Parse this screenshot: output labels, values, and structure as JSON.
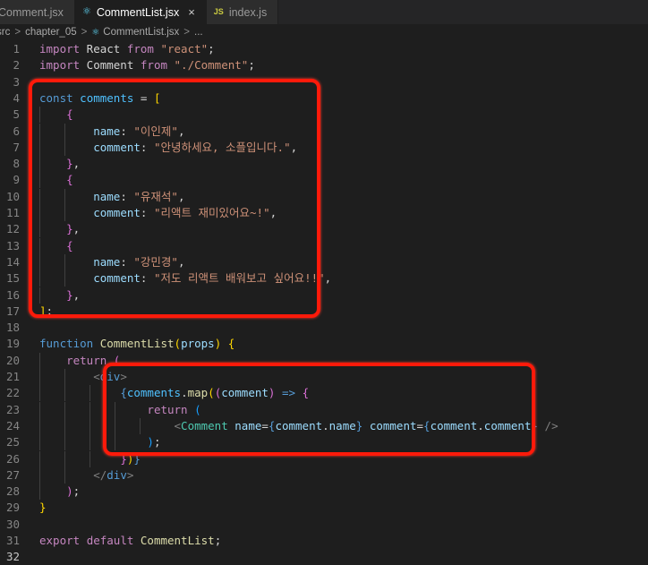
{
  "tabs": [
    {
      "label": "Comment.jsx",
      "icon": "react-icon",
      "active": false
    },
    {
      "label": "CommentList.jsx",
      "icon": "react-icon",
      "active": true,
      "close": "×"
    },
    {
      "label": "index.js",
      "icon": "js-icon",
      "icon_text": "JS",
      "active": false
    }
  ],
  "breadcrumb": {
    "items": [
      "src",
      "chapter_05",
      "CommentList.jsx",
      "..."
    ],
    "separator": ">"
  },
  "colors": {
    "background": "#1e1e1e",
    "annotation": "#ff1a0a",
    "keyword": "#569cd6",
    "control_keyword": "#c586c0",
    "string": "#ce9178",
    "property": "#9cdcfe",
    "function": "#dcdcaa",
    "component": "#4ec9b0"
  },
  "code": {
    "lines": [
      {
        "n": "1",
        "tokens": [
          [
            "kw-ctl",
            "import"
          ],
          [
            "plain",
            " React "
          ],
          [
            "kw-ctl",
            "from"
          ],
          [
            "plain",
            " "
          ],
          [
            "str",
            "\"react\""
          ],
          [
            "plain",
            ";"
          ]
        ]
      },
      {
        "n": "2",
        "tokens": [
          [
            "kw-ctl",
            "import"
          ],
          [
            "plain",
            " Comment "
          ],
          [
            "kw-ctl",
            "from"
          ],
          [
            "plain",
            " "
          ],
          [
            "str",
            "\"./Comment\""
          ],
          [
            "plain",
            ";"
          ]
        ]
      },
      {
        "n": "3",
        "tokens": []
      },
      {
        "n": "4",
        "tokens": [
          [
            "kw",
            "const"
          ],
          [
            "plain",
            " "
          ],
          [
            "var",
            "comments"
          ],
          [
            "plain",
            " = "
          ],
          [
            "br1",
            "["
          ]
        ]
      },
      {
        "n": "5",
        "tokens": [
          [
            "plain",
            "    "
          ],
          [
            "br2",
            "{"
          ]
        ]
      },
      {
        "n": "6",
        "tokens": [
          [
            "plain",
            "        "
          ],
          [
            "prop",
            "name"
          ],
          [
            "plain",
            ": "
          ],
          [
            "str",
            "\"이인제\""
          ],
          [
            "plain",
            ","
          ]
        ]
      },
      {
        "n": "7",
        "tokens": [
          [
            "plain",
            "        "
          ],
          [
            "prop",
            "comment"
          ],
          [
            "plain",
            ": "
          ],
          [
            "str",
            "\"안녕하세요, 소플입니다.\""
          ],
          [
            "plain",
            ","
          ]
        ]
      },
      {
        "n": "8",
        "tokens": [
          [
            "plain",
            "    "
          ],
          [
            "br2",
            "}"
          ],
          [
            "plain",
            ","
          ]
        ]
      },
      {
        "n": "9",
        "tokens": [
          [
            "plain",
            "    "
          ],
          [
            "br2",
            "{"
          ]
        ]
      },
      {
        "n": "10",
        "tokens": [
          [
            "plain",
            "        "
          ],
          [
            "prop",
            "name"
          ],
          [
            "plain",
            ": "
          ],
          [
            "str",
            "\"유재석\""
          ],
          [
            "plain",
            ","
          ]
        ]
      },
      {
        "n": "11",
        "tokens": [
          [
            "plain",
            "        "
          ],
          [
            "prop",
            "comment"
          ],
          [
            "plain",
            ": "
          ],
          [
            "str",
            "\"리액트 재미있어요~!\""
          ],
          [
            "plain",
            ","
          ]
        ]
      },
      {
        "n": "12",
        "tokens": [
          [
            "plain",
            "    "
          ],
          [
            "br2",
            "}"
          ],
          [
            "plain",
            ","
          ]
        ]
      },
      {
        "n": "13",
        "tokens": [
          [
            "plain",
            "    "
          ],
          [
            "br2",
            "{"
          ]
        ]
      },
      {
        "n": "14",
        "tokens": [
          [
            "plain",
            "        "
          ],
          [
            "prop",
            "name"
          ],
          [
            "plain",
            ": "
          ],
          [
            "str",
            "\"강민경\""
          ],
          [
            "plain",
            ","
          ]
        ]
      },
      {
        "n": "15",
        "tokens": [
          [
            "plain",
            "        "
          ],
          [
            "prop",
            "comment"
          ],
          [
            "plain",
            ": "
          ],
          [
            "str",
            "\"저도 리액트 배워보고 싶어요!!\""
          ],
          [
            "plain",
            ","
          ]
        ]
      },
      {
        "n": "16",
        "tokens": [
          [
            "plain",
            "    "
          ],
          [
            "br2",
            "}"
          ],
          [
            "plain",
            ","
          ]
        ]
      },
      {
        "n": "17",
        "tokens": [
          [
            "br1",
            "]"
          ],
          [
            "plain",
            ";"
          ]
        ]
      },
      {
        "n": "18",
        "tokens": []
      },
      {
        "n": "19",
        "tokens": [
          [
            "kw",
            "function"
          ],
          [
            "plain",
            " "
          ],
          [
            "fn",
            "CommentList"
          ],
          [
            "br1",
            "("
          ],
          [
            "prop",
            "props"
          ],
          [
            "br1",
            ")"
          ],
          [
            "plain",
            " "
          ],
          [
            "br1",
            "{"
          ]
        ]
      },
      {
        "n": "20",
        "tokens": [
          [
            "plain",
            "    "
          ],
          [
            "kw-ctl",
            "return"
          ],
          [
            "plain",
            " "
          ],
          [
            "br2",
            "("
          ]
        ]
      },
      {
        "n": "21",
        "tokens": [
          [
            "plain",
            "        "
          ],
          [
            "punc",
            "<"
          ],
          [
            "tag",
            "div"
          ],
          [
            "punc",
            ">"
          ]
        ]
      },
      {
        "n": "22",
        "tokens": [
          [
            "plain",
            "            "
          ],
          [
            "kw",
            "{"
          ],
          [
            "var",
            "comments"
          ],
          [
            "plain",
            "."
          ],
          [
            "fn",
            "map"
          ],
          [
            "br1",
            "("
          ],
          [
            "br2",
            "("
          ],
          [
            "prop",
            "comment"
          ],
          [
            "br2",
            ")"
          ],
          [
            "plain",
            " "
          ],
          [
            "kw",
            "=>"
          ],
          [
            "plain",
            " "
          ],
          [
            "br2",
            "{"
          ]
        ]
      },
      {
        "n": "23",
        "tokens": [
          [
            "plain",
            "                "
          ],
          [
            "kw-ctl",
            "return"
          ],
          [
            "plain",
            " "
          ],
          [
            "br3",
            "("
          ]
        ]
      },
      {
        "n": "24",
        "tokens": [
          [
            "plain",
            "                    "
          ],
          [
            "punc",
            "<"
          ],
          [
            "cls",
            "Comment"
          ],
          [
            "plain",
            " "
          ],
          [
            "prop",
            "name"
          ],
          [
            "plain",
            "="
          ],
          [
            "kw",
            "{"
          ],
          [
            "prop",
            "comment"
          ],
          [
            "plain",
            "."
          ],
          [
            "prop",
            "name"
          ],
          [
            "kw",
            "}"
          ],
          [
            "plain",
            " "
          ],
          [
            "prop",
            "comment"
          ],
          [
            "plain",
            "="
          ],
          [
            "kw",
            "{"
          ],
          [
            "prop",
            "comment"
          ],
          [
            "plain",
            "."
          ],
          [
            "prop",
            "comment"
          ],
          [
            "kw",
            "}"
          ],
          [
            "plain",
            " "
          ],
          [
            "punc",
            "/>"
          ]
        ]
      },
      {
        "n": "25",
        "tokens": [
          [
            "plain",
            "                "
          ],
          [
            "br3",
            ")"
          ],
          [
            "plain",
            ";"
          ]
        ]
      },
      {
        "n": "26",
        "tokens": [
          [
            "plain",
            "            "
          ],
          [
            "br2",
            "}"
          ],
          [
            "br1",
            ")"
          ],
          [
            "kw",
            "}"
          ]
        ]
      },
      {
        "n": "27",
        "tokens": [
          [
            "plain",
            "        "
          ],
          [
            "punc",
            "</"
          ],
          [
            "tag",
            "div"
          ],
          [
            "punc",
            ">"
          ]
        ]
      },
      {
        "n": "28",
        "tokens": [
          [
            "plain",
            "    "
          ],
          [
            "br2",
            ")"
          ],
          [
            "plain",
            ";"
          ]
        ]
      },
      {
        "n": "29",
        "tokens": [
          [
            "br1",
            "}"
          ]
        ]
      },
      {
        "n": "30",
        "tokens": []
      },
      {
        "n": "31",
        "tokens": [
          [
            "kw-ctl",
            "export"
          ],
          [
            "plain",
            " "
          ],
          [
            "kw-ctl",
            "default"
          ],
          [
            "plain",
            " "
          ],
          [
            "fn",
            "CommentList"
          ],
          [
            "plain",
            ";"
          ]
        ]
      },
      {
        "n": "32",
        "tokens": []
      }
    ]
  }
}
